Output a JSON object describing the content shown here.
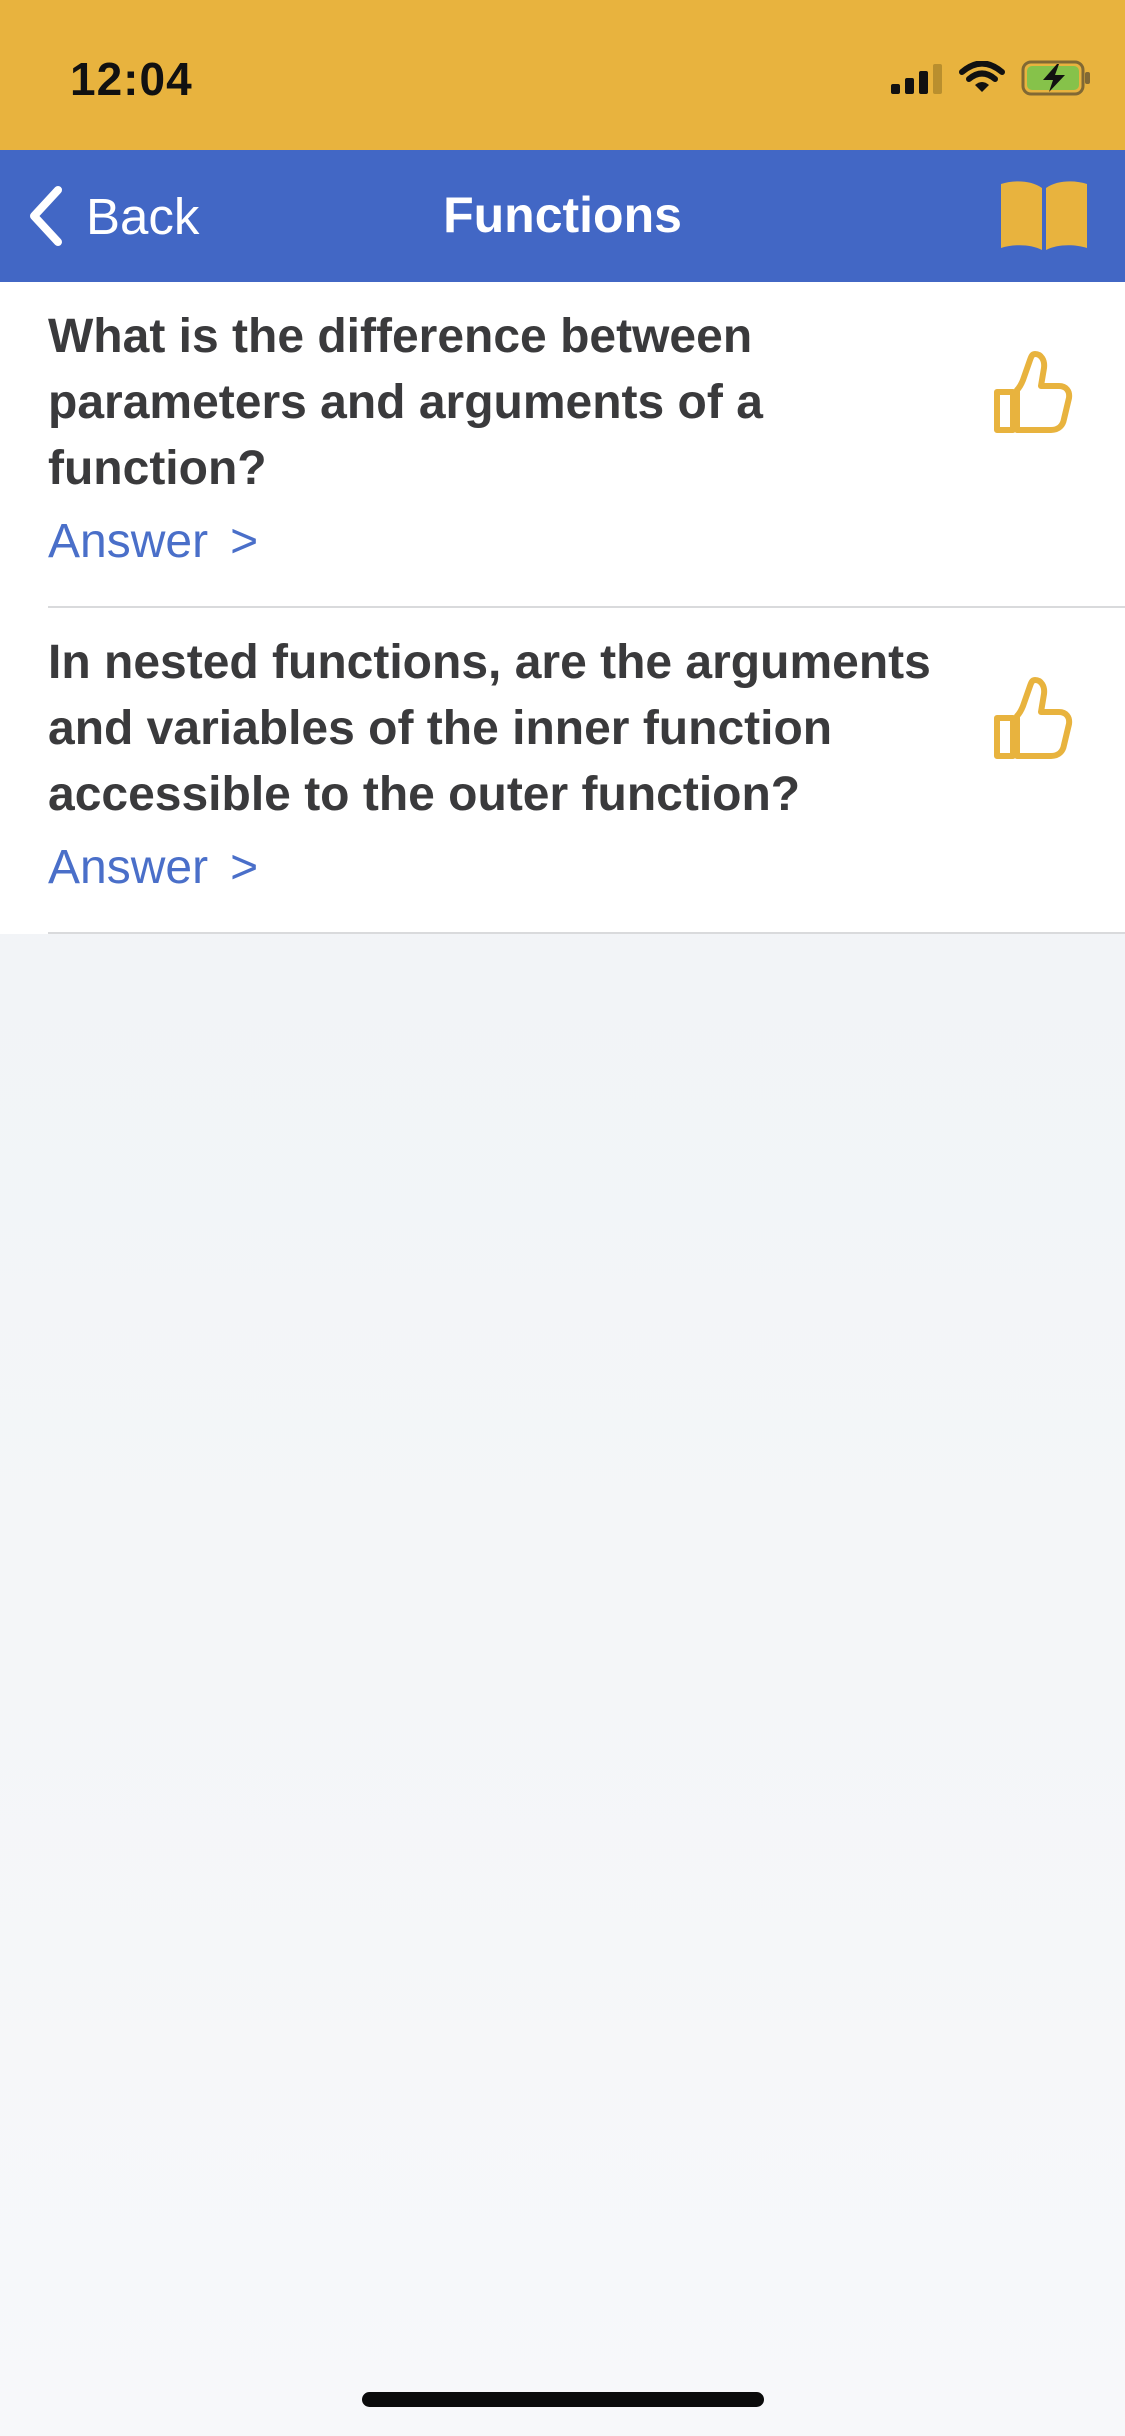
{
  "status_bar": {
    "time": "12:04",
    "icons": [
      "cellular-signal-icon",
      "wifi-icon",
      "battery-charging-icon"
    ],
    "background_color": "#e8b33e"
  },
  "nav": {
    "back_label": "Back",
    "title": "Functions",
    "right_icon": "book-icon",
    "background_color": "#4267c5"
  },
  "questions": [
    {
      "text": "What is the difference between parameters and arguments of a function?",
      "answer_label": "Answer",
      "answer_chevron": ">",
      "icon": "thumbs-up-icon"
    },
    {
      "text": "In nested functions, are the arguments and variables of the inner function accessible to the outer function?",
      "answer_label": "Answer",
      "answer_chevron": ">",
      "icon": "thumbs-up-icon"
    }
  ],
  "colors": {
    "accent_yellow": "#e8b33e",
    "link_blue": "#4a6fc9",
    "question_text": "#3a3a3c"
  }
}
